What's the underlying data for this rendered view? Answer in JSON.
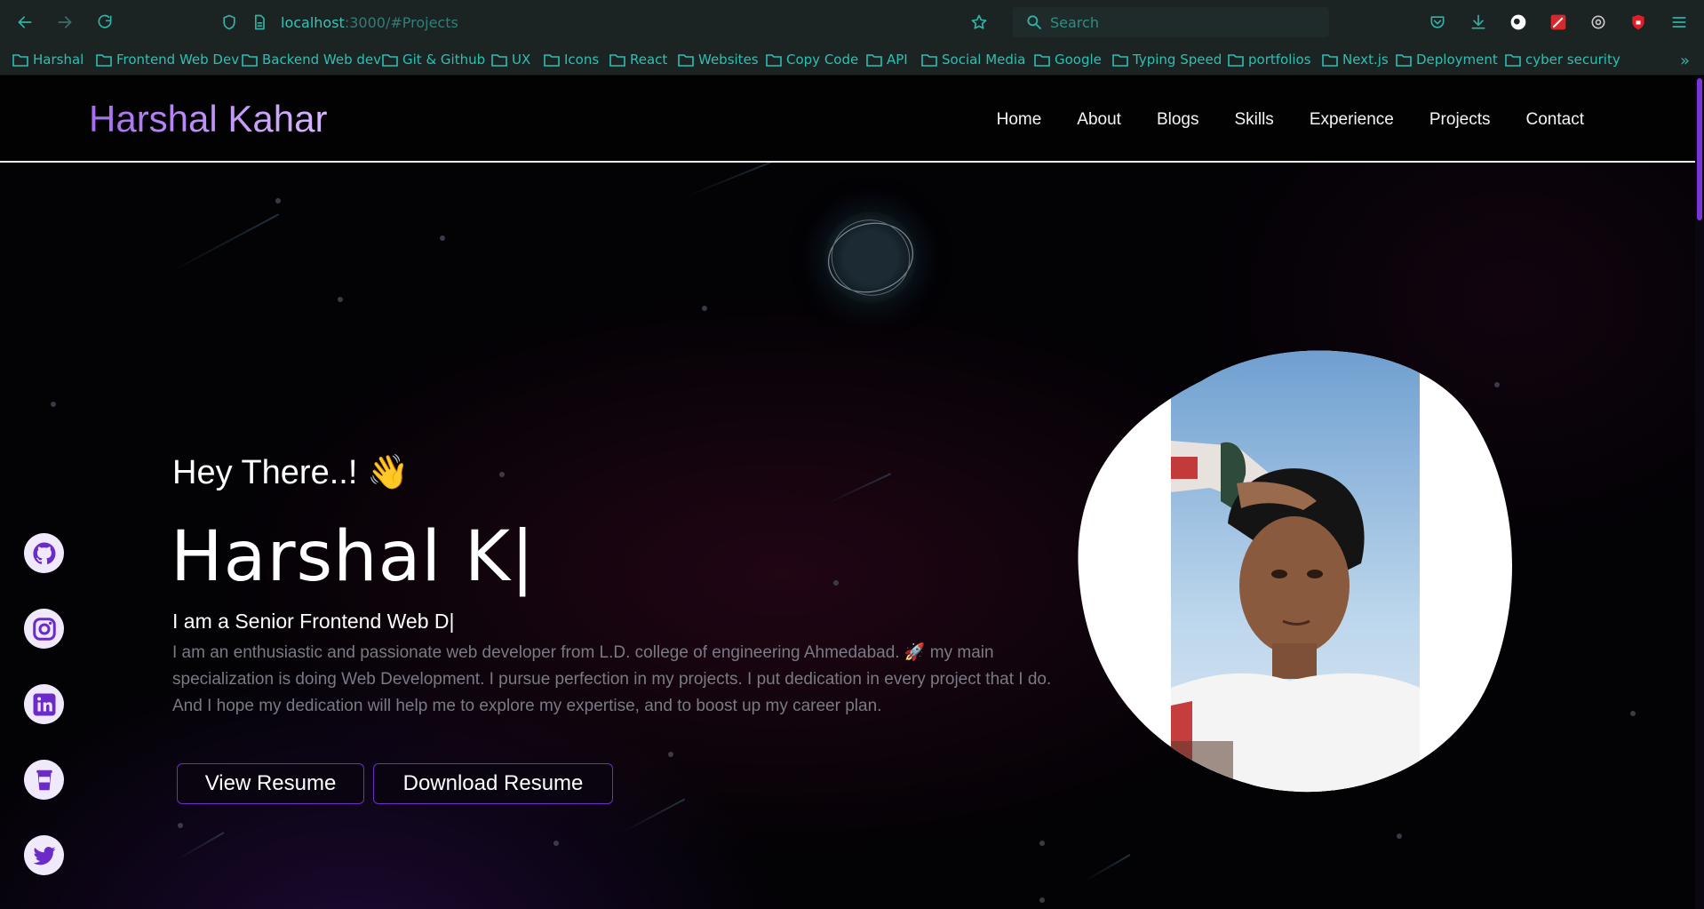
{
  "browser": {
    "url_host": "localhost",
    "url_path": ":3000/#Projects",
    "search_placeholder": "Search",
    "bookmarks": [
      "Harshal",
      "Frontend Web Dev",
      "Backend Web dev",
      "Git & Github",
      "UX",
      "Icons",
      "React",
      "Websites",
      "Copy Code",
      "API",
      "Social Media",
      "Google",
      "Typing Speed",
      "portfolios",
      "Next.js",
      "Deployment",
      "cyber security"
    ]
  },
  "site": {
    "brand": "Harshal Kahar",
    "nav": [
      "Home",
      "About",
      "Blogs",
      "Skills",
      "Experience",
      "Projects",
      "Contact"
    ]
  },
  "hero": {
    "greeting": "Hey There..!",
    "greeting_emoji": "👋",
    "name_typed": "Harshal K|",
    "role_prefix": "I am a",
    "role_typed": "Senior Frontend Web D|",
    "bio": "I am an enthusiastic and passionate web developer from L.D. college of engineering Ahmedabad. 🚀 my main specialization is doing Web Development. I pursue perfection in my projects. I put dedication in every project that I do. And I hope my dedication will help me to explore my expertise, and to boost up my career plan.",
    "view_resume": "View Resume",
    "download_resume": "Download Resume"
  },
  "socials": [
    "github-icon",
    "instagram-icon",
    "linkedin-icon",
    "buymeacoffee-icon",
    "twitter-icon"
  ],
  "colors": {
    "brand": "#b983ff",
    "accent": "#6d2fc4",
    "browser_teal": "#2cc0b3",
    "social_icon": "#6b2bc9"
  }
}
